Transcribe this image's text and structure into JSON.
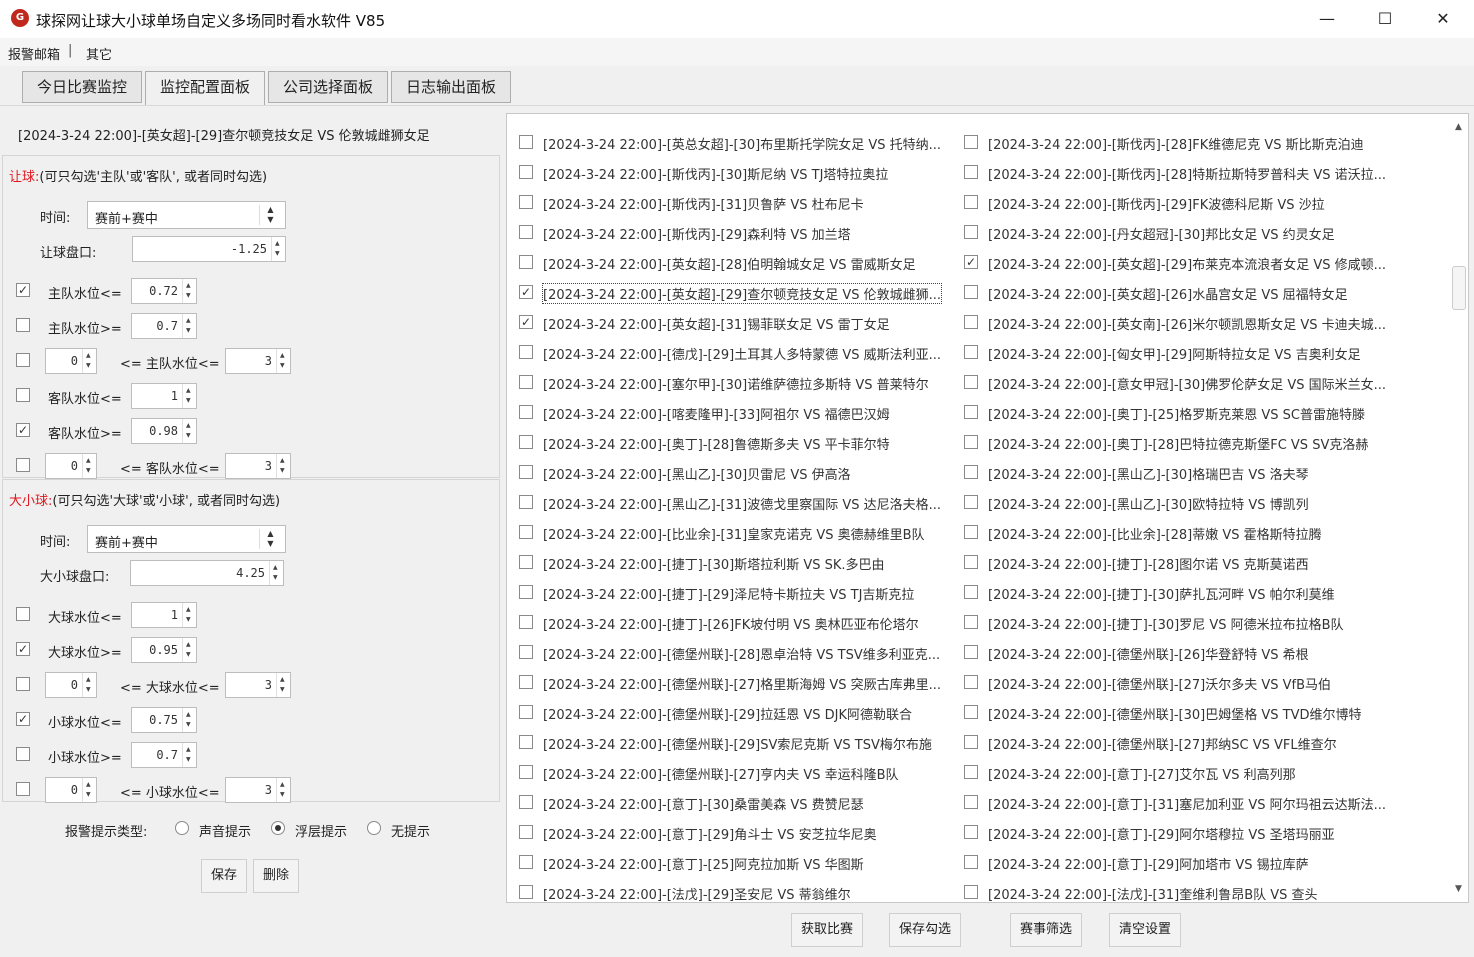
{
  "window": {
    "title": "球探网让球大小球单场自定义多场同时看水软件 V85",
    "icon_text": "G",
    "controls": {
      "minimize": "—",
      "maximize": "☐",
      "close": "✕"
    }
  },
  "menu": {
    "items": [
      "报警邮箱",
      "其它"
    ],
    "separator": "|"
  },
  "tabs": [
    "今日比赛监控",
    "监控配置面板",
    "公司选择面板",
    "日志输出面板"
  ],
  "selected_match": "[2024-3-24 22:00]-[英女超]-[29]查尔顿竞技女足 VS 伦敦城雌狮女足",
  "handicap": {
    "title_red": "让球:",
    "title_rest": "(可只勾选'主队'或'客队', 或者同时勾选)",
    "time_label": "时间:",
    "time_value": "赛前+赛中",
    "line_label": "让球盘口:",
    "line_value": "-1.25",
    "rows": [
      {
        "checked": true,
        "label": "主队水位<=",
        "value": "0.72"
      },
      {
        "checked": false,
        "label": "主队水位>=",
        "value": "0.7"
      },
      {
        "checked": false,
        "low": "0",
        "label": "<= 主队水位<=",
        "high": "3"
      },
      {
        "checked": false,
        "label": "客队水位<=",
        "value": "1"
      },
      {
        "checked": true,
        "label": "客队水位>=",
        "value": "0.98"
      },
      {
        "checked": false,
        "low": "0",
        "label": "<= 客队水位<=",
        "high": "3"
      }
    ]
  },
  "totals": {
    "title_red": "大小球:",
    "title_rest": "(可只勾选'大球'或'小球', 或者同时勾选)",
    "time_label": "时间:",
    "time_value": "赛前+赛中",
    "line_label": "大小球盘口:",
    "line_value": "4.25",
    "rows": [
      {
        "checked": false,
        "label": "大球水位<=",
        "value": "1"
      },
      {
        "checked": true,
        "label": "大球水位>=",
        "value": "0.95"
      },
      {
        "checked": false,
        "low": "0",
        "label": "<= 大球水位<=",
        "high": "3"
      },
      {
        "checked": true,
        "label": "小球水位<=",
        "value": "0.75"
      },
      {
        "checked": false,
        "label": "小球水位>=",
        "value": "0.7"
      },
      {
        "checked": false,
        "low": "0",
        "label": "<= 小球水位<=",
        "high": "3"
      }
    ]
  },
  "alert": {
    "label": "报警提示类型:",
    "options": [
      "声音提示",
      "浮层提示",
      "无提示"
    ],
    "selected": "浮层提示"
  },
  "buttons": {
    "save": "保存",
    "delete": "删除",
    "fetch": "获取比赛",
    "save_selection": "保存勾选",
    "filter": "赛事筛选",
    "clear": "清空设置"
  },
  "match_list": {
    "left": [
      {
        "checked": false,
        "text": "[2024-3-24 22:00]-[英总女超]-[30]布里斯托学院女足 VS 托特纳..."
      },
      {
        "checked": false,
        "text": "[2024-3-24 22:00]-[斯伐丙]-[30]斯尼纳 VS TJ塔特拉奥拉"
      },
      {
        "checked": false,
        "text": "[2024-3-24 22:00]-[斯伐丙]-[31]贝鲁萨 VS 杜布尼卡"
      },
      {
        "checked": false,
        "text": "[2024-3-24 22:00]-[斯伐丙]-[29]森利特 VS 加兰塔"
      },
      {
        "checked": false,
        "text": "[2024-3-24 22:00]-[英女超]-[28]伯明翰城女足 VS 雷威斯女足"
      },
      {
        "checked": true,
        "text": "[2024-3-24 22:00]-[英女超]-[29]查尔顿竞技女足 VS 伦敦城雌狮...",
        "focused": true
      },
      {
        "checked": true,
        "text": "[2024-3-24 22:00]-[英女超]-[31]锡菲联女足 VS 雷丁女足"
      },
      {
        "checked": false,
        "text": "[2024-3-24 22:00]-[德戊]-[29]土耳其人多特蒙德 VS 威斯法利亚..."
      },
      {
        "checked": false,
        "text": "[2024-3-24 22:00]-[塞尔甲]-[30]诺维萨德拉多斯特 VS 普莱特尔"
      },
      {
        "checked": false,
        "text": "[2024-3-24 22:00]-[喀麦隆甲]-[33]阿祖尔 VS 福德巴汉姆"
      },
      {
        "checked": false,
        "text": "[2024-3-24 22:00]-[奥丁]-[28]鲁德斯多夫 VS 平卡菲尔特"
      },
      {
        "checked": false,
        "text": "[2024-3-24 22:00]-[黑山乙]-[30]贝雷尼 VS 伊高洛"
      },
      {
        "checked": false,
        "text": "[2024-3-24 22:00]-[黑山乙]-[31]波德戈里察国际 VS 达尼洛夫格..."
      },
      {
        "checked": false,
        "text": "[2024-3-24 22:00]-[比业余]-[31]皇家克诺克 VS 奥德赫维里B队"
      },
      {
        "checked": false,
        "text": "[2024-3-24 22:00]-[捷丁]-[30]斯塔拉利斯 VS SK.多巴由"
      },
      {
        "checked": false,
        "text": "[2024-3-24 22:00]-[捷丁]-[29]泽尼特卡斯拉夫 VS TJ吉斯克拉"
      },
      {
        "checked": false,
        "text": "[2024-3-24 22:00]-[捷丁]-[26]FK坡付明 VS 奥林匹亚布伦塔尔"
      },
      {
        "checked": false,
        "text": "[2024-3-24 22:00]-[德堡州联]-[28]恩卓治特 VS TSV维多利亚克..."
      },
      {
        "checked": false,
        "text": "[2024-3-24 22:00]-[德堡州联]-[27]格里斯海姆 VS 突厥古库弗里..."
      },
      {
        "checked": false,
        "text": "[2024-3-24 22:00]-[德堡州联]-[29]拉廷恩 VS DJK阿德勒联合"
      },
      {
        "checked": false,
        "text": "[2024-3-24 22:00]-[德堡州联]-[29]SV索尼克斯 VS TSV梅尔布施"
      },
      {
        "checked": false,
        "text": "[2024-3-24 22:00]-[德堡州联]-[27]亨内夫 VS 幸运科隆B队"
      },
      {
        "checked": false,
        "text": "[2024-3-24 22:00]-[意丁]-[30]桑雷美森 VS 费赞尼瑟"
      },
      {
        "checked": false,
        "text": "[2024-3-24 22:00]-[意丁]-[29]角斗士 VS 安芝拉华尼奥"
      },
      {
        "checked": false,
        "text": "[2024-3-24 22:00]-[意丁]-[25]阿克拉加斯 VS 华图斯"
      },
      {
        "checked": false,
        "text": "[2024-3-24 22:00]-[法戊]-[29]圣安尼 VS 蒂翁维尔"
      }
    ],
    "right": [
      {
        "checked": false,
        "text": "[2024-3-24 22:00]-[斯伐丙]-[28]FK维德尼克 VS 斯比斯克泊迪"
      },
      {
        "checked": false,
        "text": "[2024-3-24 22:00]-[斯伐丙]-[28]特斯拉斯特罗普科夫 VS 诺沃拉..."
      },
      {
        "checked": false,
        "text": "[2024-3-24 22:00]-[斯伐丙]-[29]FK波德科尼斯 VS 沙拉"
      },
      {
        "checked": false,
        "text": "[2024-3-24 22:00]-[丹女超冠]-[30]邦比女足 VS 约灵女足"
      },
      {
        "checked": true,
        "text": "[2024-3-24 22:00]-[英女超]-[29]布莱克本流浪者女足 VS 修咸顿..."
      },
      {
        "checked": false,
        "text": "[2024-3-24 22:00]-[英女超]-[26]水晶宫女足 VS 屈福特女足"
      },
      {
        "checked": false,
        "text": "[2024-3-24 22:00]-[英女南]-[26]米尔顿凯恩斯女足 VS 卡迪夫城..."
      },
      {
        "checked": false,
        "text": "[2024-3-24 22:00]-[匈女甲]-[29]阿斯特拉女足 VS 吉奥利女足"
      },
      {
        "checked": false,
        "text": "[2024-3-24 22:00]-[意女甲冠]-[30]佛罗伦萨女足 VS 国际米兰女..."
      },
      {
        "checked": false,
        "text": "[2024-3-24 22:00]-[奥丁]-[25]格罗斯克莱恩 VS SC普雷施特滕"
      },
      {
        "checked": false,
        "text": "[2024-3-24 22:00]-[奥丁]-[28]巴特拉德克斯堡FC VS SV克洛赫"
      },
      {
        "checked": false,
        "text": "[2024-3-24 22:00]-[黑山乙]-[30]格瑞巴吉 VS 洛夫琴"
      },
      {
        "checked": false,
        "text": "[2024-3-24 22:00]-[黑山乙]-[30]欧特拉特 VS 博凯列"
      },
      {
        "checked": false,
        "text": "[2024-3-24 22:00]-[比业余]-[28]蒂嫩 VS 霍格斯特拉腾"
      },
      {
        "checked": false,
        "text": "[2024-3-24 22:00]-[捷丁]-[28]图尔诺 VS 克斯莫诺西"
      },
      {
        "checked": false,
        "text": "[2024-3-24 22:00]-[捷丁]-[30]萨扎瓦河畔 VS 帕尔利莫维"
      },
      {
        "checked": false,
        "text": "[2024-3-24 22:00]-[捷丁]-[30]罗尼 VS 阿德米拉布拉格B队"
      },
      {
        "checked": false,
        "text": "[2024-3-24 22:00]-[德堡州联]-[26]华登舒特 VS 希根"
      },
      {
        "checked": false,
        "text": "[2024-3-24 22:00]-[德堡州联]-[27]沃尔多夫 VS VfB马伯"
      },
      {
        "checked": false,
        "text": "[2024-3-24 22:00]-[德堡州联]-[30]巴姆堡格 VS TVD维尔博特"
      },
      {
        "checked": false,
        "text": "[2024-3-24 22:00]-[德堡州联]-[27]邦纳SC VS VFL维查尔"
      },
      {
        "checked": false,
        "text": "[2024-3-24 22:00]-[意丁]-[27]艾尔瓦 VS 利高列那"
      },
      {
        "checked": false,
        "text": "[2024-3-24 22:00]-[意丁]-[31]塞尼加利亚 VS 阿尔玛祖云达斯法..."
      },
      {
        "checked": false,
        "text": "[2024-3-24 22:00]-[意丁]-[29]阿尔塔穆拉 VS 圣塔玛丽亚"
      },
      {
        "checked": false,
        "text": "[2024-3-24 22:00]-[意丁]-[29]阿加塔市 VS 锡拉库萨"
      },
      {
        "checked": false,
        "text": "[2024-3-24 22:00]-[法戊]-[31]奎维利鲁昂B队 VS 查头"
      }
    ]
  }
}
